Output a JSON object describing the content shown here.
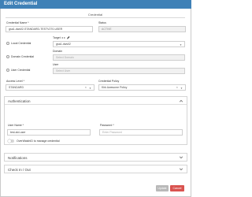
{
  "window": {
    "title": "Edit Credential"
  },
  "section": {
    "title": "Credential"
  },
  "credential_name": {
    "label": "Credential Name *",
    "value": "gsa1-dws02-STANDARD-TESTV270-USER"
  },
  "status": {
    "label": "Status",
    "value": "ACTIVE"
  },
  "scope": {
    "local": {
      "label": "Local Credential",
      "selected": true
    },
    "domain": {
      "label": "Domain Credential",
      "selected": false
    },
    "user": {
      "label": "User Credential",
      "selected": false
    }
  },
  "target": {
    "label": "Target",
    "value": "gsa1-dws02"
  },
  "domain_field": {
    "label": "Domain",
    "placeholder": "Select Domain"
  },
  "user_field": {
    "label": "User",
    "placeholder": "Select User"
  },
  "access_level": {
    "label": "Access Level *",
    "value": "STANDARD"
  },
  "credential_policy": {
    "label": "Credential Policy",
    "value": "Kirk Awesome Policy"
  },
  "auth_panel": {
    "title": "Authentication",
    "user_name": {
      "label": "User Name *",
      "value": "test-std-user"
    },
    "password": {
      "label": "Password *",
      "placeholder": "Enter Password"
    },
    "toggle_label": "OverWatchID to manage credential",
    "toggle_on": false
  },
  "notifications_panel": {
    "title": "Notifications"
  },
  "checkin_panel": {
    "title": "Check In / Out"
  },
  "buttons": {
    "update": "Update",
    "cancel": "Cancel"
  },
  "colors": {
    "titlebar": "#3f81b7",
    "cancel": "#d9534f",
    "update_disabled": "#b9b9b9"
  },
  "icons": [
    "link-icon",
    "edit-icon",
    "caret-down-icon",
    "clear-icon",
    "chevron-up-icon",
    "chevron-down-icon"
  ]
}
